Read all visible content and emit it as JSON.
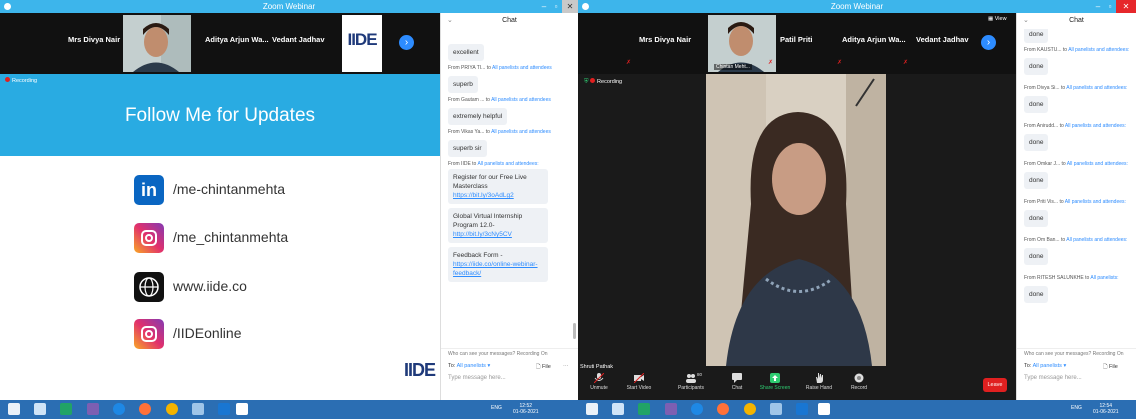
{
  "left": {
    "title": "Zoom Webinar",
    "win_controls": {
      "min": "–",
      "max": "▫",
      "close": "✕"
    },
    "panelists": [
      "Mrs Divya Nair",
      "Aditya Arjun Wa...",
      "Vedant Jadhav"
    ],
    "recording": "Recording",
    "slide": {
      "heading": "Follow Me for Updates",
      "linkedin": "/me-chintanmehta",
      "instagram": "/me_chintanmehta",
      "website": "www.iide.co",
      "instagram2": "/IIDEonline",
      "logo": "IIDE"
    },
    "chat": {
      "header": "Chat",
      "messages": [
        {
          "from": "",
          "to": "",
          "text": "excellent"
        },
        {
          "from": "From PRIYA TI... to",
          "to": "All panelists and attendees",
          "text": "superb"
        },
        {
          "from": "From Gautam ... to",
          "to": "All panelists and attendees",
          "text": "extremely helpful"
        },
        {
          "from": "From Vikas Ya... to",
          "to": "All panelists and attendees",
          "text": "superb sir"
        }
      ],
      "iide_from": "From IIDE to",
      "iide_to": "All panelists and attendees:",
      "iide_msgs": [
        {
          "text": "Register for our Free Live Masterclass",
          "link": "https://bit.ly/3oAdLg2"
        },
        {
          "text": "Global Virtual Internship Program 12.0-",
          "link": "http://bit.ly/3cNy5CV"
        },
        {
          "text": "Feedback Form -",
          "link": "https://iide.co/online-webinar-feedback/"
        }
      ],
      "footer_note": "Who can see your messages? Recording On",
      "to_label": "To:",
      "to_value": "All panelists ▾",
      "file_label": "File",
      "more": "···",
      "placeholder": "Type message here..."
    },
    "taskbar": {
      "tray": "ENG",
      "time": "12:52",
      "date": "01-06-2021"
    }
  },
  "right": {
    "title": "Zoom Webinar",
    "view_label": "View",
    "panelists": [
      "Mrs Divya Nair",
      "Patil Priti",
      "Aditya Arjun Wa...",
      "Vedant Jadhav"
    ],
    "tile_name": "Chintan Meht...",
    "recording": "Recording",
    "speaker_name": "Shruti Pathak",
    "toolbar": {
      "unmute": "Unmute",
      "start_video": "Start Video",
      "participants": "Participants",
      "participant_count": "80",
      "chat": "Chat",
      "share_screen": "Share Screen",
      "raise_hand": "Raise Hand",
      "record": "Record",
      "leave": "Leave"
    },
    "chat": {
      "header": "Chat",
      "top_partial": "done",
      "messages": [
        {
          "from": "From KAUSTU... to",
          "to": "All panelists and attendees:",
          "text": "done"
        },
        {
          "from": "From Divya Si... to",
          "to": "All panelists and attendees:",
          "text": "done"
        },
        {
          "from": "From Anirudd... to",
          "to": "All panelists and attendees:",
          "text": "done"
        },
        {
          "from": "From Omkar J... to",
          "to": "All panelists and attendees:",
          "text": "done"
        },
        {
          "from": "From Priti Vis... to",
          "to": "All panelists and attendees:",
          "text": "done"
        },
        {
          "from": "From Om Ban... to",
          "to": "All panelists and attendees:",
          "text": "done"
        },
        {
          "from": "From RITESH SALUNKHE to",
          "to": "All panelists:",
          "text": "done"
        }
      ],
      "footer_note": "Who can see your messages? Recording On",
      "to_label": "To:",
      "to_value": "All panelists ▾",
      "file_label": "File",
      "placeholder": "Type message here..."
    },
    "taskbar": {
      "tray": "ENG",
      "time": "12:54",
      "date": "01-06-2021"
    }
  },
  "colors": {
    "zoom_blue": "#2d8cff",
    "title_bar": "#3db5eb",
    "slide_banner": "#29abe2",
    "leave": "#e02020",
    "taskbar": "#2b6eb3"
  }
}
